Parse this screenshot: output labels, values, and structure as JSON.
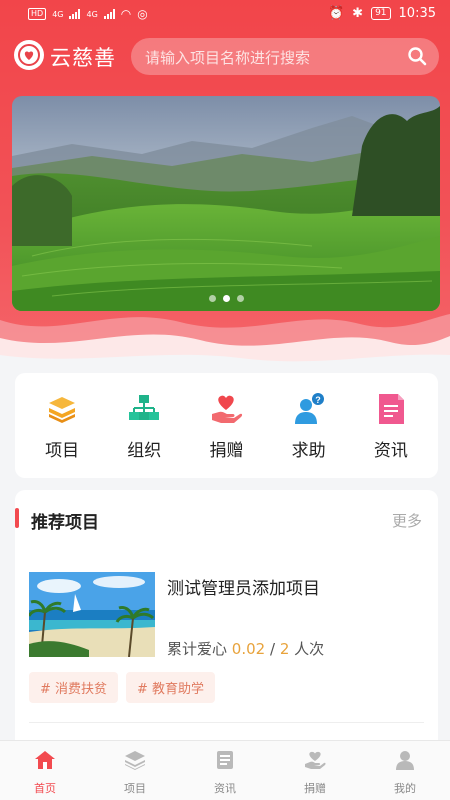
{
  "status_bar": {
    "left_tag": "HD",
    "net1": "4G",
    "net2": "4G",
    "battery": "91",
    "time": "10:35"
  },
  "header": {
    "brand": "云慈善",
    "search_placeholder": "请输入项目名称进行搜索"
  },
  "banner": {
    "slides": 3,
    "active_slide": 2
  },
  "categories": [
    {
      "label": "项目",
      "icon": "books-icon"
    },
    {
      "label": "组织",
      "icon": "org-chart-icon"
    },
    {
      "label": "捐赠",
      "icon": "heart-hand-icon"
    },
    {
      "label": "求助",
      "icon": "person-question-icon"
    },
    {
      "label": "资讯",
      "icon": "document-icon"
    }
  ],
  "recommend": {
    "title": "推荐项目",
    "more": "更多",
    "project": {
      "name": "测试管理员添加项目",
      "stats_label": "累计爱心",
      "love_amount": "0.02",
      "sep": "/",
      "count": "2",
      "count_unit": "人次",
      "tags": [
        "# 消费扶贫",
        "# 教育助学"
      ]
    }
  },
  "tabbar": [
    {
      "label": "首页",
      "icon": "home-icon",
      "active": true
    },
    {
      "label": "项目",
      "icon": "layers-icon",
      "active": false
    },
    {
      "label": "资讯",
      "icon": "news-icon",
      "active": false
    },
    {
      "label": "捐赠",
      "icon": "donate-icon",
      "active": false
    },
    {
      "label": "我的",
      "icon": "user-icon",
      "active": false
    }
  ],
  "colors": {
    "brand_red": "#f24a4f",
    "accent_orange": "#e8a33c",
    "tag_bg": "#fdf0ec",
    "tag_text": "#e07a5f"
  }
}
